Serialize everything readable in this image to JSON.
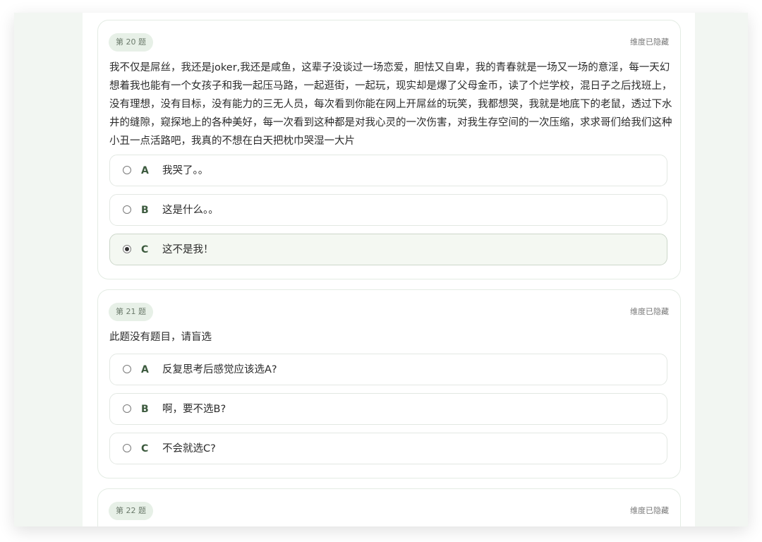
{
  "questions": [
    {
      "badge": "第 20 题",
      "dimension": "维度已隐藏",
      "text": "我不仅是屌丝，我还是joker,我还是咸鱼，这辈子没谈过一场恋爱，胆怯又自卑，我的青春就是一场又一场的意淫，每一天幻想着我也能有一个女孩子和我一起压马路，一起逛街，一起玩，现实却是爆了父母金币，读了个烂学校，混日子之后找班上，没有理想，没有目标，没有能力的三无人员，每次看到你能在网上开屌丝的玩笑，我都想哭，我就是地底下的老鼠，透过下水井的缝隙，窥探地上的各种美好，每一次看到这种都是对我心灵的一次伤害，对我生存空间的一次压缩，求求哥们给我们这种小丑一点活路吧，我真的不想在白天把枕巾哭湿一大片",
      "options": [
        {
          "letter": "A",
          "text": "我哭了。。",
          "selected": false
        },
        {
          "letter": "B",
          "text": "这是什么。。",
          "selected": false
        },
        {
          "letter": "C",
          "text": "这不是我！",
          "selected": true
        }
      ]
    },
    {
      "badge": "第 21 题",
      "dimension": "维度已隐藏",
      "text": "此题没有题目，请盲选",
      "options": [
        {
          "letter": "A",
          "text": "反复思考后感觉应该选A?",
          "selected": false
        },
        {
          "letter": "B",
          "text": "啊，要不选B?",
          "selected": false
        },
        {
          "letter": "C",
          "text": "不会就选C?",
          "selected": false
        }
      ]
    },
    {
      "badge": "第 22 题",
      "dimension": "维度已隐藏"
    }
  ]
}
